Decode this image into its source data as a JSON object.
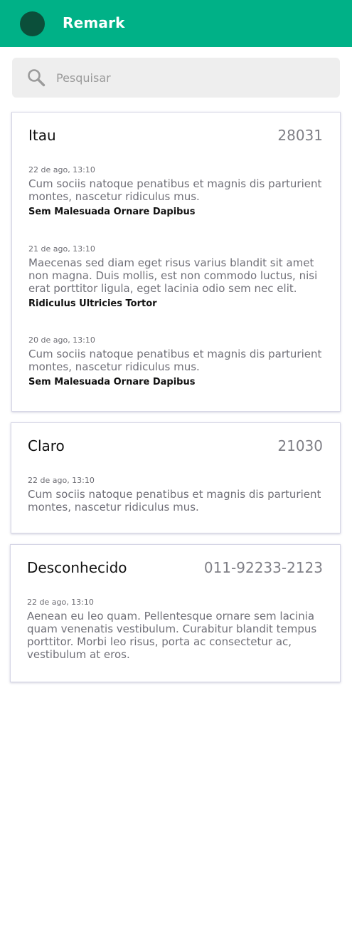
{
  "appbar": {
    "title": "Remark",
    "color": "#00b187",
    "avatar_color": "#0b4f3a"
  },
  "search": {
    "placeholder": "Pesquisar",
    "value": "",
    "icon": "search-icon"
  },
  "conversations": [
    {
      "name": "Itau",
      "number": "28031",
      "messages": [
        {
          "time": "22 de ago, 13:10",
          "body": "Cum sociis natoque penatibus et magnis dis parturient montes, nascetur ridiculus mus.",
          "tag": "Sem Malesuada Ornare Dapibus"
        },
        {
          "time": "21 de ago, 13:10",
          "body": "Maecenas sed diam eget risus varius blandit sit amet non magna. Duis mollis, est non commodo luctus, nisi erat porttitor ligula, eget lacinia odio sem nec elit.",
          "tag": "Ridiculus Ultricies Tortor"
        },
        {
          "time": "20 de ago, 13:10",
          "body": "Cum sociis natoque penatibus et magnis dis parturient montes, nascetur ridiculus mus.",
          "tag": "Sem Malesuada Ornare Dapibus"
        }
      ]
    },
    {
      "name": "Claro",
      "number": "21030",
      "messages": [
        {
          "time": "22 de ago, 13:10",
          "body": "Cum sociis natoque penatibus et magnis dis parturient montes, nascetur ridiculus mus."
        }
      ]
    },
    {
      "name": "Desconhecido",
      "number": "011-92233-2123",
      "messages": [
        {
          "time": "22 de ago, 13:10",
          "body": "Aenean eu leo quam. Pellentesque ornare sem lacinia quam venenatis vestibulum. Curabitur blandit tempus porttitor. Morbi leo risus, porta ac consectetur ac, vestibulum at eros."
        }
      ]
    }
  ]
}
